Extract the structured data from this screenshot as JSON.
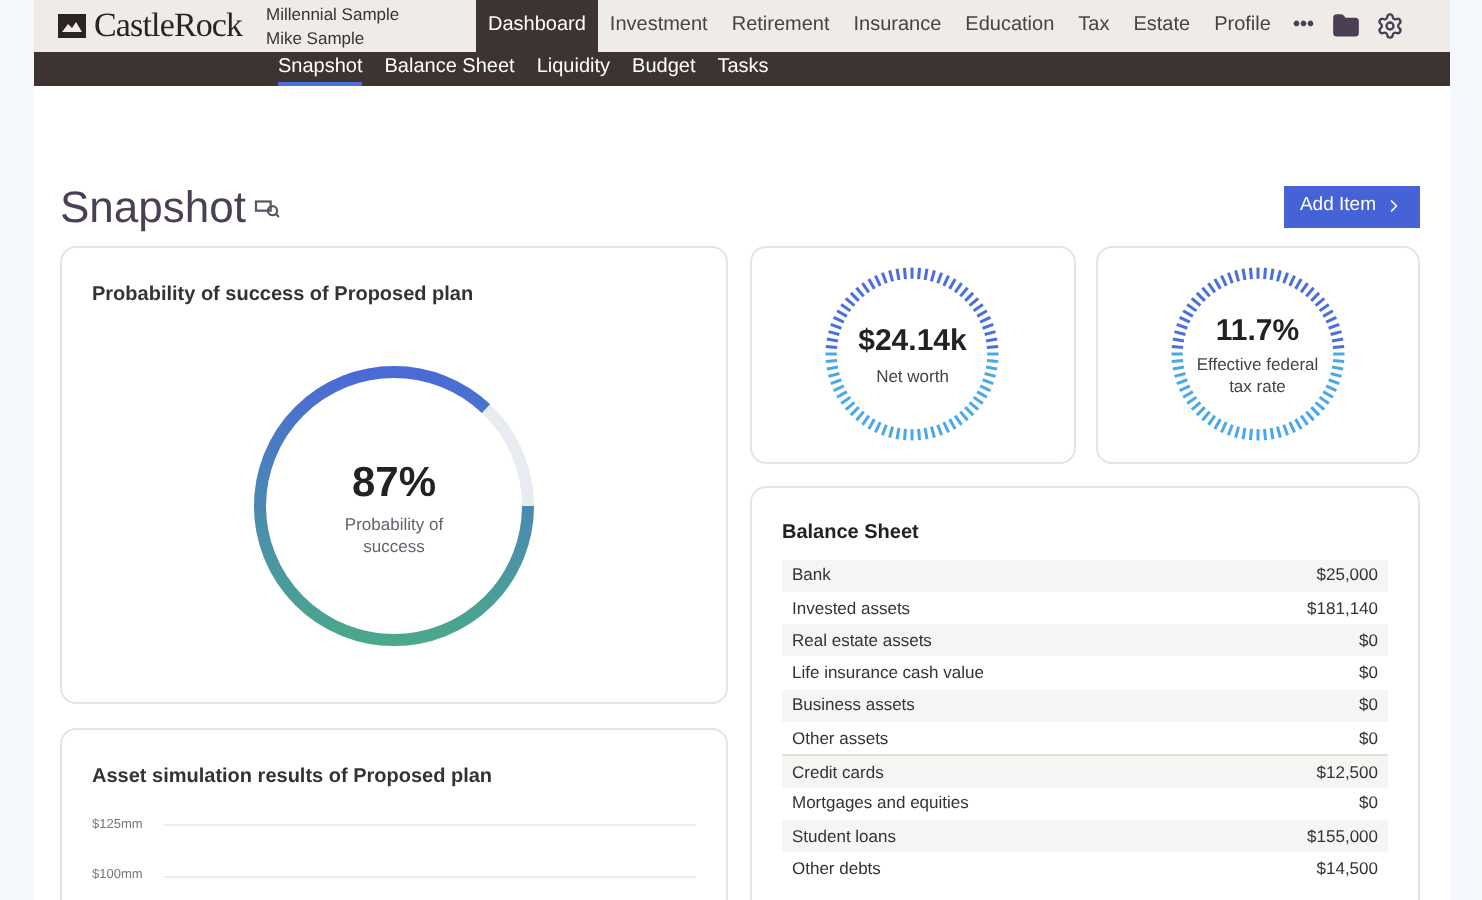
{
  "header": {
    "logo": "CastleRock",
    "plan": "Millennial Sample",
    "client": "Mike Sample",
    "tabs": [
      {
        "label": "Dashboard",
        "selected": true
      },
      {
        "label": "Investment",
        "selected": false
      },
      {
        "label": "Retirement",
        "selected": false
      },
      {
        "label": "Insurance",
        "selected": false
      },
      {
        "label": "Education",
        "selected": false
      },
      {
        "label": "Tax",
        "selected": false
      },
      {
        "label": "Estate",
        "selected": false
      },
      {
        "label": "Profile",
        "selected": false
      }
    ],
    "more": "•••"
  },
  "subnav": [
    {
      "label": "Snapshot",
      "selected": true
    },
    {
      "label": "Balance Sheet",
      "selected": false
    },
    {
      "label": "Liquidity",
      "selected": false
    },
    {
      "label": "Budget",
      "selected": false
    },
    {
      "label": "Tasks",
      "selected": false
    }
  ],
  "page": {
    "title": "Snapshot",
    "add_button": "Add Item"
  },
  "probability_card": {
    "title": "Probability of success of Proposed plan",
    "value": "87%",
    "caption": "Probability of success",
    "level": 0.87
  },
  "net_worth": {
    "value": "$24.14k",
    "caption": "Net worth"
  },
  "tax_rate": {
    "value": "11.7%",
    "caption": "Effective federal tax rate"
  },
  "simulation_card": {
    "title": "Asset simulation results of Proposed plan",
    "y_labels": [
      "$125mm",
      "$100mm"
    ]
  },
  "balance_sheet": {
    "title": "Balance Sheet",
    "rows": [
      {
        "label": "Bank",
        "value": "$25,000",
        "kind": "asset"
      },
      {
        "label": "Invested assets",
        "value": "$181,140",
        "kind": "asset"
      },
      {
        "label": "Real estate assets",
        "value": "$0",
        "kind": "asset"
      },
      {
        "label": "Life insurance cash value",
        "value": "$0",
        "kind": "asset"
      },
      {
        "label": "Business assets",
        "value": "$0",
        "kind": "asset"
      },
      {
        "label": "Other assets",
        "value": "$0",
        "kind": "asset"
      },
      {
        "label": "Credit cards",
        "value": "$12,500",
        "kind": "debt"
      },
      {
        "label": "Mortgages and equities",
        "value": "$0",
        "kind": "debt"
      },
      {
        "label": "Student loans",
        "value": "$155,000",
        "kind": "debt"
      },
      {
        "label": "Other debts",
        "value": "$14,500",
        "kind": "debt"
      }
    ]
  }
}
